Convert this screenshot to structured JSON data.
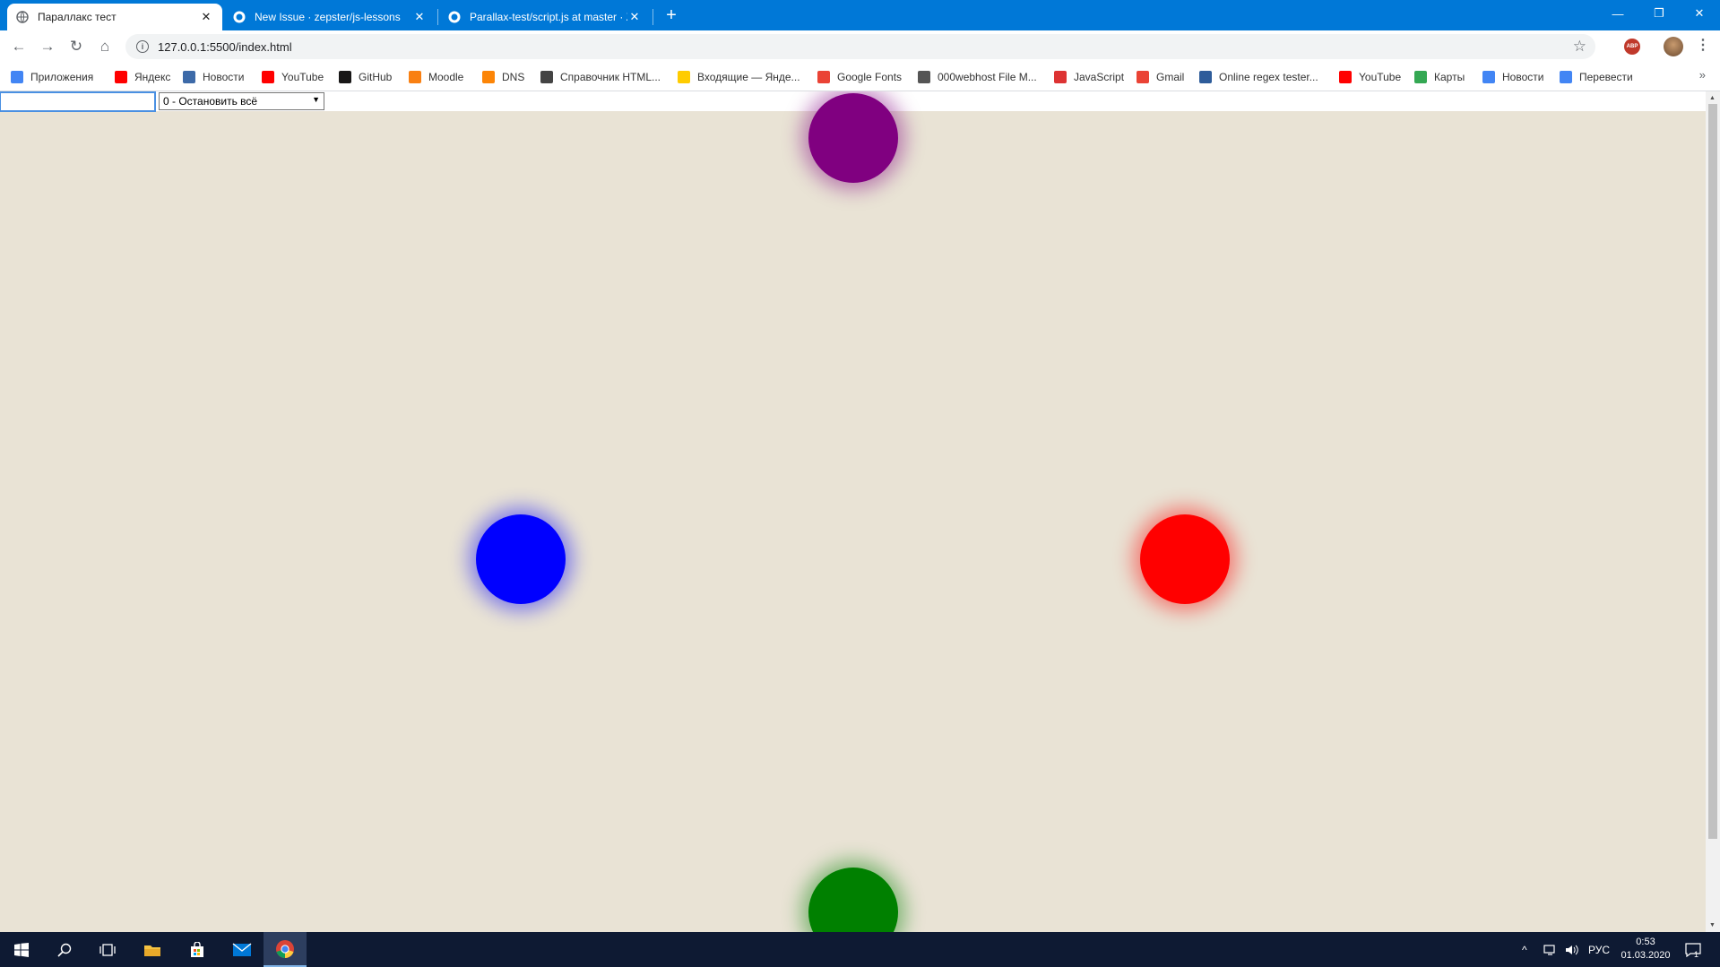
{
  "tabs": [
    {
      "title": "Параллакс тест",
      "close": "✕",
      "icon": "globe-icon"
    },
    {
      "title": "New Issue · zepster/js-lessons",
      "close": "✕",
      "icon": "github-icon"
    },
    {
      "title": "Parallax-test/script.js at master · Z",
      "close": "✕",
      "icon": "github-icon"
    }
  ],
  "new_tab": "+",
  "window_controls": {
    "minimize": "—",
    "restore": "❐",
    "close": "✕"
  },
  "toolbar": {
    "url": "127.0.0.1:5500/index.html",
    "info": "i",
    "star": "☆",
    "back": "←",
    "forward": "→",
    "reload": "↻",
    "home": "⌂",
    "abp": "ABP",
    "menu": "⋮"
  },
  "bookmarks": [
    {
      "label": "Приложения",
      "icon": "apps-icon",
      "color": "#4285f4"
    },
    {
      "label": "Яндекс",
      "icon": "yandex-icon",
      "color": "#ff0000"
    },
    {
      "label": "Новости",
      "icon": "news-icon",
      "color": "#3d6aa8"
    },
    {
      "label": "YouTube",
      "icon": "youtube-icon",
      "color": "#ff0000"
    },
    {
      "label": "GitHub",
      "icon": "github-icon",
      "color": "#181717"
    },
    {
      "label": "Moodle",
      "icon": "moodle-icon",
      "color": "#f98012"
    },
    {
      "label": "DNS",
      "icon": "dns-icon",
      "color": "#fc8507"
    },
    {
      "label": "Справочник HTML...",
      "icon": "chat-icon",
      "color": "#444444"
    },
    {
      "label": "Входящие — Янде...",
      "icon": "mail-icon",
      "color": "#ffcc00"
    },
    {
      "label": "Google Fonts",
      "icon": "fonts-icon",
      "color": "#ea4335"
    },
    {
      "label": "000webhost File M...",
      "icon": "globe-icon",
      "color": "#555555"
    },
    {
      "label": "JavaScript",
      "icon": "javascript-icon",
      "color": "#d33"
    },
    {
      "label": "Gmail",
      "icon": "gmail-icon",
      "color": "#ea4335"
    },
    {
      "label": "Online regex tester...",
      "icon": "regex-icon",
      "color": "#2e5c9a"
    },
    {
      "label": "YouTube",
      "icon": "youtube-icon",
      "color": "#ff0000"
    },
    {
      "label": "Карты",
      "icon": "maps-icon",
      "color": "#34a853"
    },
    {
      "label": "Новости",
      "icon": "google-news-icon",
      "color": "#4285f4"
    },
    {
      "label": "Перевести",
      "icon": "translate-icon",
      "color": "#4285f4"
    }
  ],
  "bookmarks_more": "»",
  "page": {
    "input_value": "",
    "select_value": "0 - Остановить всё",
    "balls": [
      {
        "name": "purple-ball",
        "color": "#800080"
      },
      {
        "name": "blue-ball",
        "color": "#0000ff"
      },
      {
        "name": "red-ball",
        "color": "#ff0000"
      },
      {
        "name": "green-ball",
        "color": "#008000"
      }
    ]
  },
  "taskbar": {
    "apps": [
      "windows-start-icon",
      "search-icon",
      "task-view-icon",
      "file-explorer-icon",
      "store-icon",
      "mail-icon",
      "chrome-icon"
    ],
    "language": "РУС",
    "time": "0:53",
    "date": "01.03.2020",
    "notifications": "1"
  }
}
